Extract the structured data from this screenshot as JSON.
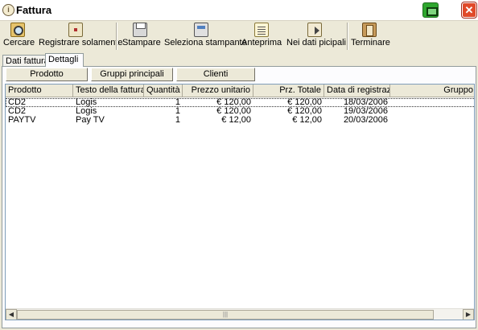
{
  "window": {
    "title": "Fattura",
    "app_icon": "info-icon"
  },
  "titlebar_buttons": {
    "green": "printer-green-icon",
    "close": "close-icon",
    "close_glyph": "✕"
  },
  "toolbar": {
    "items": [
      {
        "label": "Cercare",
        "icon": "search-icon"
      },
      {
        "label": "Registrare solamente",
        "icon": "register-icon"
      },
      {
        "label": "Stampare",
        "icon": "printer-icon"
      },
      {
        "label": "Seleziona stampante",
        "icon": "printer-select-icon"
      },
      {
        "label": "Anteprima",
        "icon": "preview-icon"
      },
      {
        "label": "Nei dati picipali",
        "icon": "details-icon"
      },
      {
        "label": "Terminare",
        "icon": "exit-icon"
      }
    ]
  },
  "tabs": [
    {
      "label": "Dati fattura",
      "active": false
    },
    {
      "label": "Dettagli",
      "active": true
    }
  ],
  "sub_buttons": [
    "Prodotto",
    "Gruppi principali",
    "Clienti"
  ],
  "table": {
    "columns": [
      "Prodotto",
      "Testo della fattura",
      "Quantità",
      "Prezzo unitario",
      "Prz. Totale",
      "Data di registraz...",
      "Gruppo"
    ],
    "rows": [
      [
        "CD2",
        "Logis",
        "1",
        "€ 120,00",
        "€ 120,00",
        "18/03/2006",
        ""
      ],
      [
        "CD2",
        "Logis",
        "1",
        "€ 120,00",
        "€ 120,00",
        "19/03/2006",
        ""
      ],
      [
        "PAYTV",
        "Pay TV",
        "1",
        "€ 12,00",
        "€ 12,00",
        "20/03/2006",
        ""
      ]
    ]
  },
  "scrollbar": {
    "left_arrow": "◀",
    "right_arrow": "▶",
    "thumb_grip": "|||"
  }
}
